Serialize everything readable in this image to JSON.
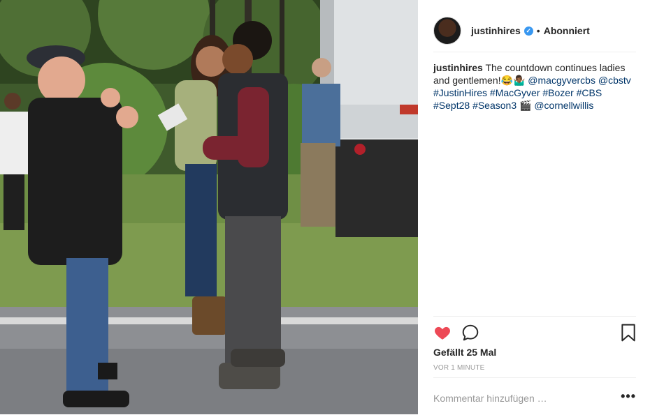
{
  "post": {
    "photo_alt": "",
    "header": {
      "username": "justinhires",
      "verified_icon": "✓",
      "separator": "•",
      "follow_state": "Abonniert"
    },
    "caption": {
      "username": "justinhires",
      "text": "The countdown continues ladies and gentlemen!😂🤷🏾‍♂️",
      "mention_1": "@macgyvercbs",
      "mention_2": "@cbstv",
      "hashtag_1": "#JustinHires",
      "hashtag_2": "#MacGyver",
      "hashtag_3": "#Bozer",
      "hashtag_4": "#CBS",
      "hashtag_5": "#Sept28",
      "hashtag_6": "#Season3",
      "emoji_end": "🎬",
      "mention_3": "@cornellwillis"
    },
    "actions": {
      "like_icon": "heart-icon",
      "comment_icon": "comment-icon",
      "save_icon": "bookmark-icon",
      "liked": true,
      "like_color": "#ed4956"
    },
    "likes_text": "Gefällt 25 Mal",
    "timestamp": "VOR 1 MINUTE",
    "comment_placeholder": "Kommentar hinzufügen …",
    "more_icon": "•••"
  }
}
